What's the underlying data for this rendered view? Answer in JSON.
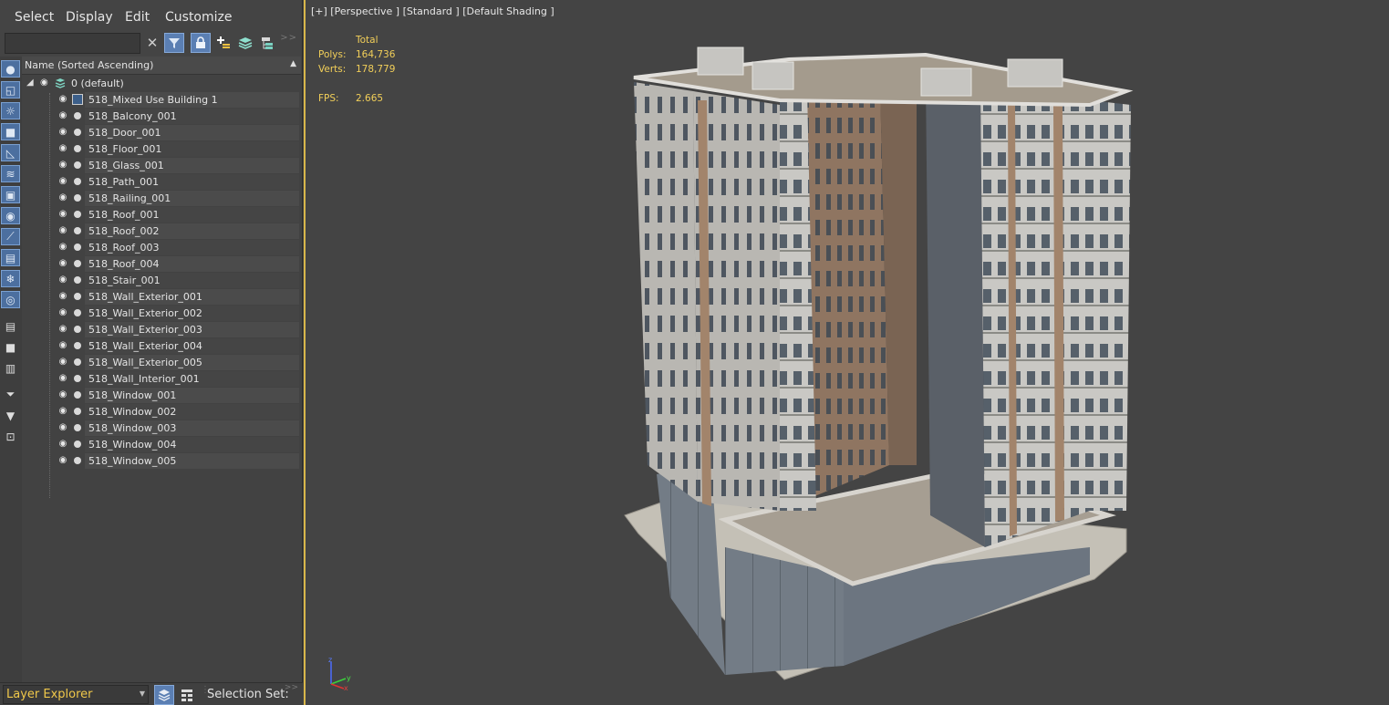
{
  "menubar": {
    "items": [
      "Select",
      "Display",
      "Edit",
      "Customize"
    ]
  },
  "toolbar": {
    "search_value": "",
    "icons": [
      "clear-icon",
      "filter-icon",
      "lock-icon",
      "add-layer-icon",
      "layers-icon",
      "hierarchy-icon"
    ]
  },
  "sidebar": {
    "icons": [
      "sphere-icon",
      "shape-icon",
      "light-icon",
      "camera-icon",
      "helper-icon",
      "spacewarp-icon",
      "group-icon",
      "xref-icon",
      "bone-icon",
      "container-icon",
      "frozen-icon",
      "hidden-icon",
      "select-all-icon",
      "select-none-icon",
      "invert-icon",
      "filter-icon",
      "funnel-icon",
      "selection-set-icon"
    ]
  },
  "tree": {
    "column_header": "Name (Sorted Ascending)",
    "root_layer": "0 (default)",
    "rows": [
      "518_Mixed Use Building 1",
      "518_Balcony_001",
      "518_Door_001",
      "518_Floor_001",
      "518_Glass_001",
      "518_Path_001",
      "518_Railing_001",
      "518_Roof_001",
      "518_Roof_002",
      "518_Roof_003",
      "518_Roof_004",
      "518_Stair_001",
      "518_Wall_Exterior_001",
      "518_Wall_Exterior_002",
      "518_Wall_Exterior_003",
      "518_Wall_Exterior_004",
      "518_Wall_Exterior_005",
      "518_Wall_Interior_001",
      "518_Window_001",
      "518_Window_002",
      "518_Window_003",
      "518_Window_004",
      "518_Window_005"
    ]
  },
  "bottombar": {
    "explorer_name": "Layer Explorer",
    "selection_set_label": "Selection Set:"
  },
  "viewport": {
    "label": "[+] [Perspective ] [Standard ] [Default Shading ]",
    "stats": {
      "total_label": "Total",
      "polys_label": "Polys:",
      "polys_value": "164,736",
      "verts_label": "Verts:",
      "verts_value": "178,779",
      "fps_label": "FPS:",
      "fps_value": "2.665"
    },
    "axis_labels": {
      "z": "z",
      "y": "y",
      "x": "x"
    }
  },
  "colors": {
    "accent_yellow": "#f2cf59",
    "selection_blue": "#5b7fb3",
    "viewport_border": "#d9b74a"
  }
}
